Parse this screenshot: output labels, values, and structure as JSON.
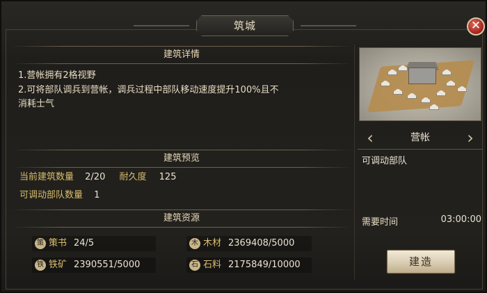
{
  "window": {
    "title": "筑城",
    "close_glyph": "✕"
  },
  "details": {
    "heading": "建筑详情",
    "lines": [
      "1.营帐拥有2格视野",
      "2.可将部队调兵到营帐，调兵过程中部队移动速度提升100%且不",
      "消耗士气"
    ]
  },
  "preview_info": {
    "heading": "建筑预览",
    "current_count_label": "当前建筑数量",
    "current_count_value": "2/20",
    "durability_label": "耐久度",
    "durability_value": "125",
    "movable_label": "可调动部队数量",
    "movable_value": "1"
  },
  "resources": {
    "heading": "建筑资源",
    "items": [
      {
        "name": "策书",
        "value": "24/5",
        "icon": "book-seal-icon",
        "glyph": "策"
      },
      {
        "name": "木材",
        "value": "2369408/5000",
        "icon": "wood-icon",
        "glyph": "木"
      },
      {
        "name": "铁矿",
        "value": "2390551/5000",
        "icon": "iron-ore-icon",
        "glyph": "铁"
      },
      {
        "name": "石料",
        "value": "2175849/10000",
        "icon": "stone-icon",
        "glyph": "石"
      }
    ]
  },
  "building": {
    "name": "营帐",
    "description": "可调动部队",
    "time_label": "需要时间",
    "time_value": "03:00:00",
    "build_label": "建造",
    "prev_glyph": "‹",
    "next_glyph": "›"
  },
  "colors": {
    "accent_gold": "#d9bd6c",
    "close_red": "#a3221a",
    "text": "#e8dcc3"
  }
}
